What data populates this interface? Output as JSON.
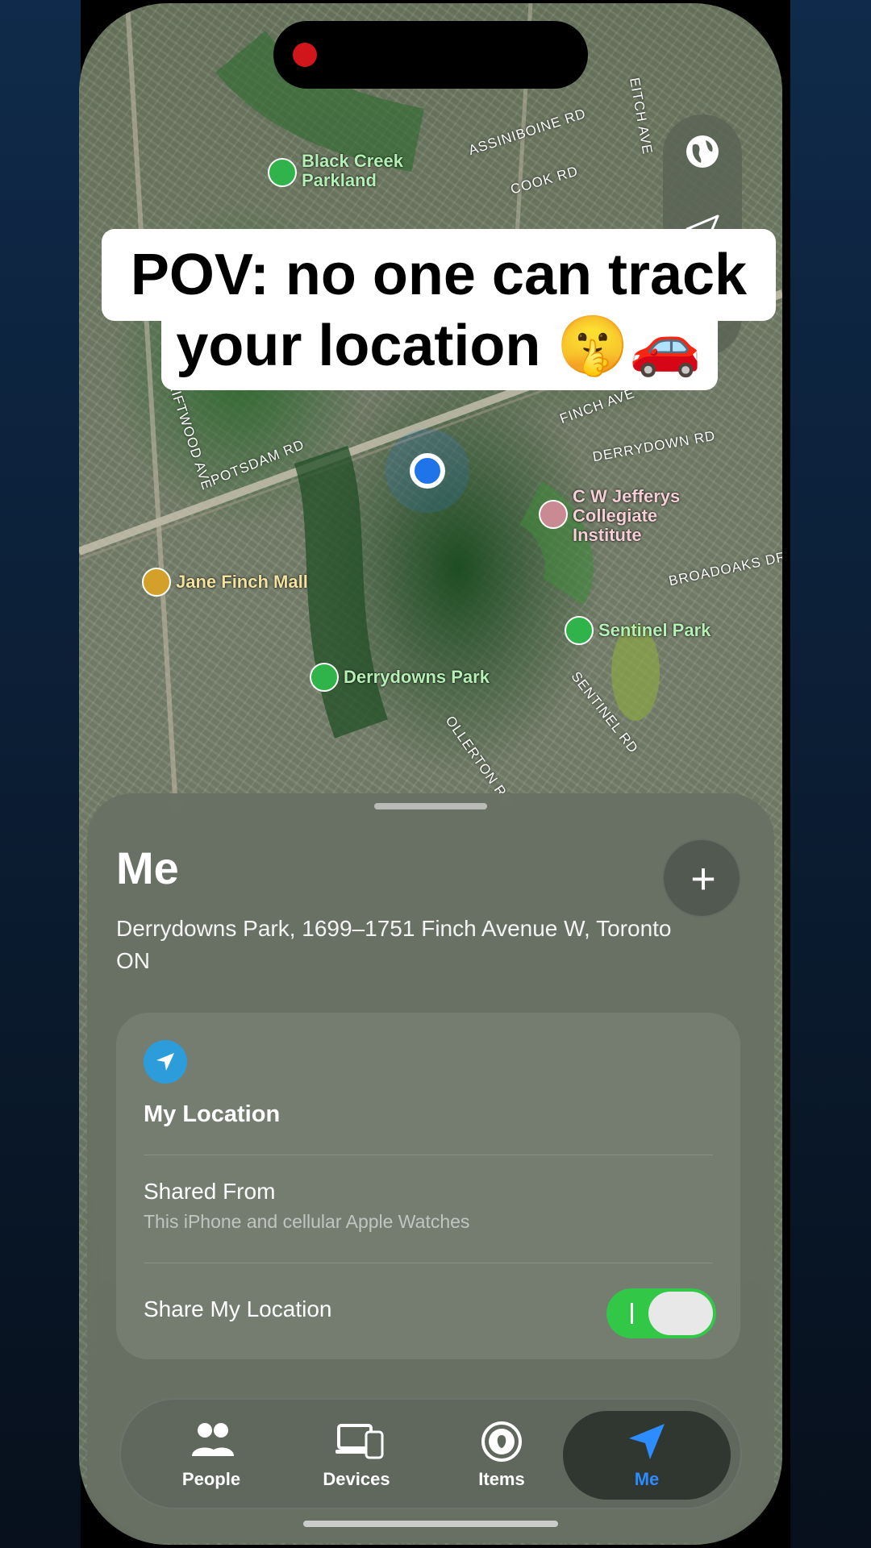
{
  "caption": {
    "line1": "POV: no one can track",
    "line2": "your location 🤫🚗"
  },
  "map": {
    "streets": [
      "ASSINIBOINE RD",
      "COOK RD",
      "FINCH AVE",
      "DRIFTWOOD AVE",
      "POTSDAM RD",
      "DERRYDOWN RD",
      "BROADOAKS DR",
      "SENTINEL RD",
      "OLLERTON RD",
      "EITCH AVE"
    ],
    "places": {
      "black_creek": "Black Creek\nParkland",
      "jefferys": "C W Jefferys\nCollegiate\nInstitute",
      "jane_finch": "Jane Finch Mall",
      "sentinel_park": "Sentinel Park",
      "derrydowns": "Derrydowns Park"
    }
  },
  "sheet": {
    "title": "Me",
    "add_label": "+",
    "address": "Derrydowns Park, 1699–1751 Finch Avenue W, Toronto ON",
    "card": {
      "my_location": "My Location",
      "shared_from": "Shared From",
      "shared_from_detail": "This iPhone and cellular Apple Watches",
      "share_my_location": "Share My Location",
      "share_enabled": true
    }
  },
  "tabs": [
    {
      "label": "People",
      "icon": "people-icon"
    },
    {
      "label": "Devices",
      "icon": "devices-icon"
    },
    {
      "label": "Items",
      "icon": "items-icon"
    },
    {
      "label": "Me",
      "icon": "location-arrow-icon",
      "active": true
    }
  ],
  "colors": {
    "accent_blue": "#2d8cff",
    "toggle_green": "#33c748",
    "record_red": "#d0161b"
  }
}
